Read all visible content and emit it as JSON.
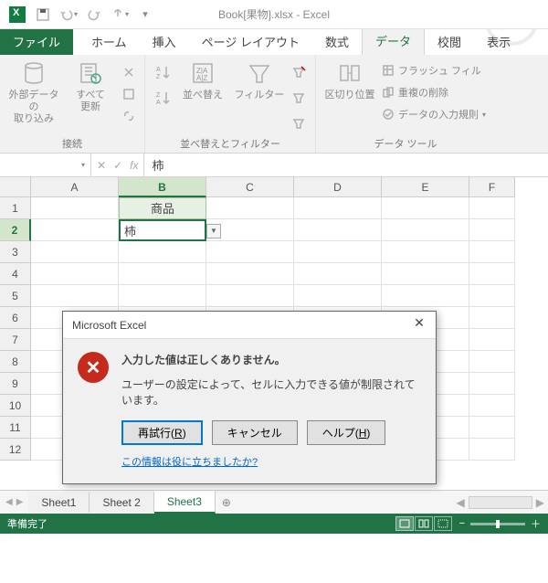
{
  "title": "Book[果物].xlsx - Excel",
  "qat": {
    "save": "save",
    "undo": "undo",
    "redo": "redo",
    "touch": "touch-mode"
  },
  "tabs": {
    "file": "ファイル",
    "home": "ホーム",
    "insert": "挿入",
    "pagelayout": "ページ レイアウト",
    "formulas": "数式",
    "data": "データ",
    "review": "校閲",
    "view": "表示"
  },
  "ribbon": {
    "external_data": "外部データの\n取り込み",
    "refresh_all": "すべて\n更新",
    "connections_group": "接続",
    "sort": "並べ替え",
    "filter": "フィルター",
    "sortfilter_group": "並べ替えとフィルター",
    "text_to_cols": "区切り位置",
    "flash_fill": "フラッシュ フィル",
    "remove_dup": "重複の削除",
    "data_valid": "データの入力規則",
    "datatools_group": "データ ツール"
  },
  "formula_bar": {
    "name_box": "",
    "fx": "fx",
    "value": "柿"
  },
  "columns": [
    "A",
    "B",
    "C",
    "D",
    "E",
    "F"
  ],
  "rows": [
    "1",
    "2",
    "3",
    "4",
    "5",
    "6",
    "7",
    "8",
    "9",
    "10",
    "11",
    "12"
  ],
  "cells": {
    "B1": "商品",
    "B2": "柿"
  },
  "active_cell": "B2",
  "dialog": {
    "title": "Microsoft Excel",
    "msg1": "入力した値は正しくありません。",
    "msg2": "ユーザーの設定によって、セルに入力できる値が制限されています。",
    "retry": "再試行",
    "retry_key": "R",
    "cancel": "キャンセル",
    "help": "ヘルプ",
    "help_key": "H",
    "feedback": "この情報は役に立ちましたか?"
  },
  "sheets": {
    "nav_prev": "◀",
    "nav_next": "▶",
    "s1": "Sheet1",
    "s2": "Sheet 2",
    "s3": "Sheet3",
    "add": "⊕"
  },
  "status": {
    "ready": "準備完了",
    "minus": "−",
    "plus": "＋"
  }
}
